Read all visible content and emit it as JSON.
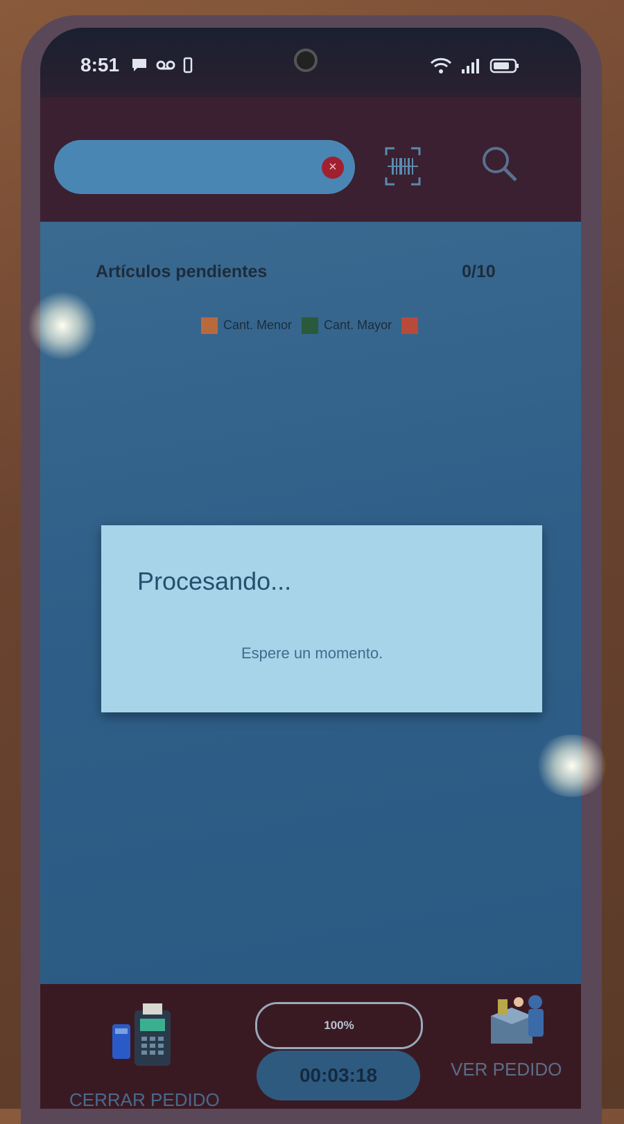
{
  "status_bar": {
    "time": "8:51"
  },
  "search": {
    "placeholder": "",
    "clear_icon": "×"
  },
  "list": {
    "pending_label": "Artículos pendientes",
    "pending_count": "0/10",
    "legend": [
      {
        "label": "Cant. Menor",
        "color": "#b86a3c"
      },
      {
        "label": "Cant. Mayor",
        "color": "#2a5a3c"
      },
      {
        "label": "",
        "color": "#b84a3a"
      }
    ]
  },
  "dialog": {
    "title": "Procesando...",
    "message": "Espere un momento."
  },
  "bottom_bar": {
    "close_order_label": "CERRAR PEDIDO",
    "progress_text": "100%",
    "progress_value": 1.0,
    "timer": "00:03:18",
    "view_order_label": "VER PEDIDO"
  },
  "colors": {
    "dialog_bg": "#a8d4ea",
    "main_bg": "#2f5f88",
    "bar_bg": "#3a1a22"
  }
}
